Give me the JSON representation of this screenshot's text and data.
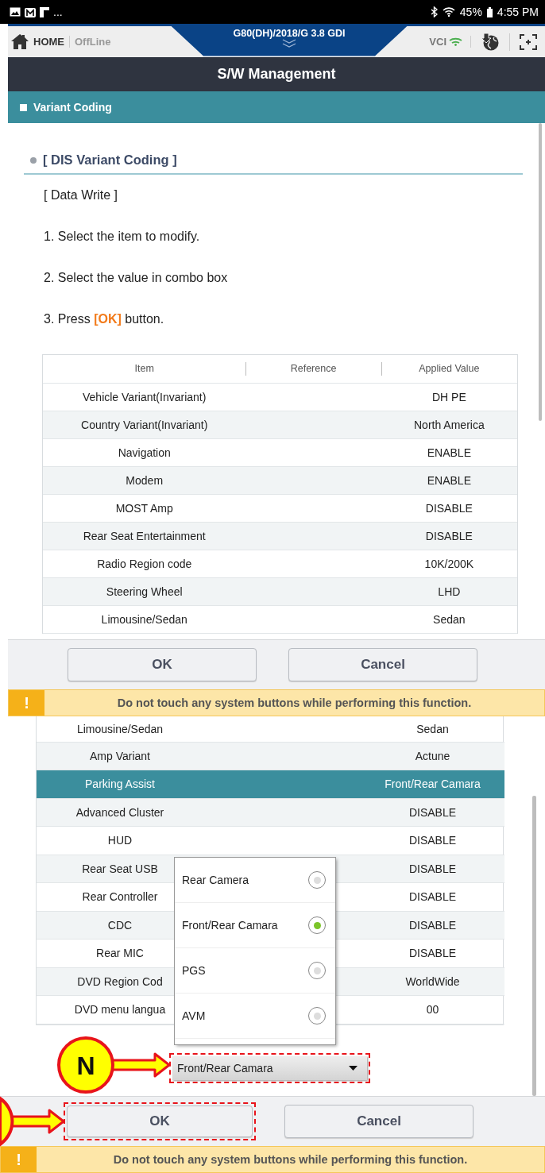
{
  "status_bar": {
    "notification_more": "...",
    "battery": "45%",
    "time": "4:55 PM"
  },
  "header": {
    "home_label": "HOME",
    "connection": "OffLine",
    "vehicle": "G80(DH)/2018/G 3.8 GDI",
    "vci_label": "VCI"
  },
  "title": "S/W Management",
  "section": "Variant Coding",
  "first_view": {
    "heading": "[ DIS Variant Coding ]",
    "instructions": [
      "[ Data Write ]",
      "1. Select the item to modify.",
      "2. Select the value in combo box",
      "3. Press **[OK]** button."
    ],
    "table": {
      "columns": [
        "Item",
        "Reference",
        "Applied Value"
      ],
      "rows": [
        {
          "item": "Vehicle Variant(Invariant)",
          "value": "DH PE",
          "selected": false
        },
        {
          "item": "Country Variant(Invariant)",
          "value": "North America",
          "selected": false
        },
        {
          "item": "Navigation",
          "value": "ENABLE",
          "selected": false
        },
        {
          "item": "Modem",
          "value": "ENABLE",
          "selected": false
        },
        {
          "item": "MOST Amp",
          "value": "DISABLE",
          "selected": false
        },
        {
          "item": "Rear Seat Entertainment",
          "value": "DISABLE",
          "selected": false
        },
        {
          "item": "Radio Region code",
          "value": "10K/200K",
          "selected": false
        },
        {
          "item": "Steering Wheel",
          "value": "LHD",
          "selected": false
        },
        {
          "item": "Limousine/Sedan",
          "value": "Sedan",
          "selected": false
        }
      ]
    },
    "buttons": [
      {
        "label": "OK",
        "annotated": false
      },
      {
        "label": "Cancel",
        "annotated": false
      }
    ],
    "warning": {
      "icon": "!",
      "text": "Do not touch any system buttons while performing this function."
    }
  },
  "second_view": {
    "table": {
      "rows": [
        {
          "item": "Limousine/Sedan",
          "value": "Sedan",
          "selected": false
        },
        {
          "item": "Amp Variant",
          "value": "Actune",
          "selected": false
        },
        {
          "item": "Parking Assist",
          "value": "Front/Rear Camara",
          "selected": true
        },
        {
          "item": "Advanced Cluster",
          "value": "DISABLE",
          "selected": false
        },
        {
          "item": "HUD",
          "value": "DISABLE",
          "selected": false
        },
        {
          "item": "Rear Seat USB",
          "value": "DISABLE",
          "selected": false
        },
        {
          "item": "Rear Controller",
          "value": "DISABLE",
          "selected": false
        },
        {
          "item": "CDC",
          "value": "DISABLE",
          "selected": false
        },
        {
          "item": "Rear MIC",
          "value": "DISABLE",
          "selected": false
        },
        {
          "item": "DVD Region Cod",
          "value": "WorldWide",
          "selected": false
        },
        {
          "item": "DVD menu langua",
          "value": "00",
          "selected": false
        }
      ]
    },
    "dropdown": {
      "options": [
        {
          "label": "Rear Camera",
          "selected": false
        },
        {
          "label": "Front/Rear Camara",
          "selected": true
        },
        {
          "label": "PGS",
          "selected": false
        },
        {
          "label": "AVM",
          "selected": false
        }
      ]
    },
    "combo_box": {
      "value": "Front/Rear Camara",
      "annotated": true
    },
    "callouts": [
      {
        "kind": "combo",
        "label": "N"
      },
      {
        "kind": "button"
      }
    ],
    "buttons": [
      {
        "label": "OK",
        "annotated": true
      },
      {
        "label": "Cancel",
        "annotated": false
      }
    ],
    "warning": {
      "icon": "!",
      "text": "Do not touch any system buttons while performing this function."
    }
  }
}
